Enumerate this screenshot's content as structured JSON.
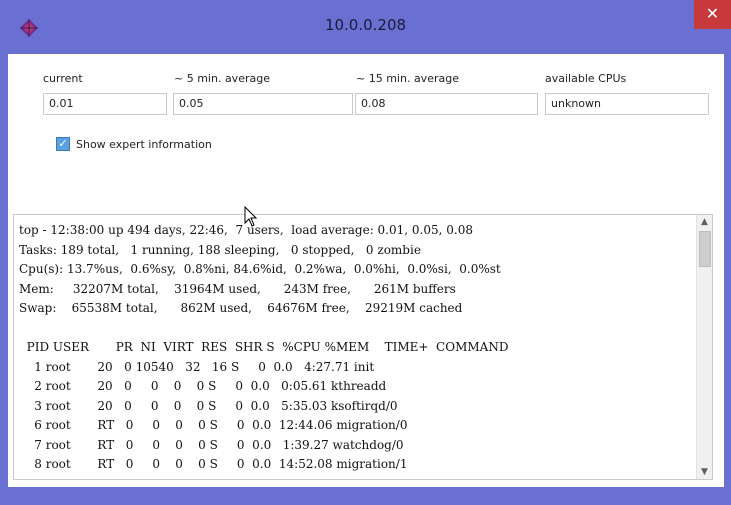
{
  "window": {
    "title": "10.0.0.208",
    "close_label": "✕"
  },
  "fields": [
    {
      "label": "current",
      "value": "0.01"
    },
    {
      "label": "~ 5 min. average",
      "value": "0.05"
    },
    {
      "label": "~ 15 min. average",
      "value": "0.08"
    },
    {
      "label": "available CPUs",
      "value": "unknown"
    }
  ],
  "expert": {
    "label": "Show expert information",
    "checked": true,
    "check_mark": "✓"
  },
  "terminal": {
    "lines": [
      "top - 12:38:00 up 494 days, 22:46,  7 users,  load average: 0.01, 0.05, 0.08",
      "Tasks: 189 total,   1 running, 188 sleeping,   0 stopped,   0 zombie",
      "Cpu(s): 13.7%us,  0.6%sy,  0.8%ni, 84.6%id,  0.2%wa,  0.0%hi,  0.0%si,  0.0%st",
      "Mem:     32207M total,    31964M used,      243M free,      261M buffers",
      "Swap:    65538M total,      862M used,    64676M free,    29219M cached",
      "",
      "  PID USER       PR  NI  VIRT  RES  SHR S  %CPU %MEM    TIME+  COMMAND",
      "    1 root       20   0 10540   32   16 S     0  0.0   4:27.71 init",
      "    2 root       20   0     0    0    0 S     0  0.0   0:05.61 kthreadd",
      "    3 root       20   0     0    0    0 S     0  0.0   5:35.03 ksoftirqd/0",
      "    6 root       RT   0     0    0    0 S     0  0.0  12:44.06 migration/0",
      "    7 root       RT   0     0    0    0 S     0  0.0   1:39.27 watchdog/0",
      "    8 root       RT   0     0    0    0 S     0  0.0  14:52.08 migration/1"
    ]
  },
  "scrollbar": {
    "up_arrow": "▲",
    "down_arrow": "▼"
  }
}
